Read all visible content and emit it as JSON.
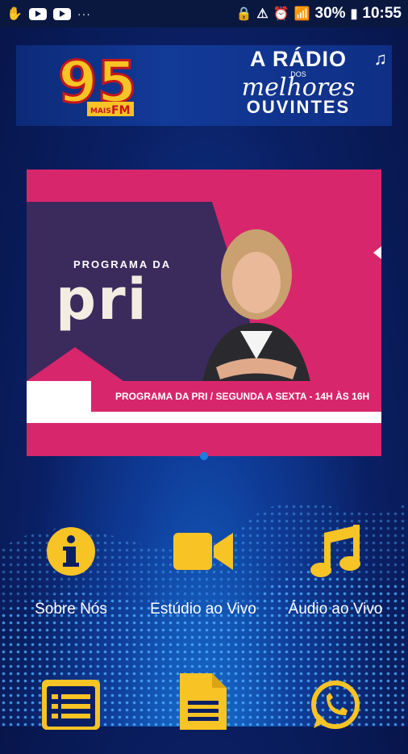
{
  "status_bar": {
    "battery_percent": "30%",
    "time": "10:55",
    "more_dots": "···"
  },
  "header": {
    "logo_number": "95",
    "logo_sub_left": "MAIS",
    "logo_sub_right": "FM",
    "slogan_line1": "A RÁDIO",
    "slogan_line2": "DOS",
    "slogan_line3": "melhores",
    "slogan_line4": "OUVINTES"
  },
  "carousel": {
    "program_kicker": "PROGRAMA DA",
    "program_name": "pri",
    "schedule_text": "PROGRAMA DA PRI  /  SEGUNDA A SEXTA - 14H ÀS 16H"
  },
  "menu": {
    "items": [
      {
        "label": "Sobre Nós",
        "icon": "info-icon"
      },
      {
        "label": "Estúdio ao Vivo",
        "icon": "video-camera-icon"
      },
      {
        "label": "Áudio ao Vivo",
        "icon": "music-note-icon"
      },
      {
        "label": "",
        "icon": "list-icon"
      },
      {
        "label": "",
        "icon": "document-icon"
      },
      {
        "label": "",
        "icon": "whatsapp-icon"
      }
    ]
  },
  "colors": {
    "accent_yellow": "#f7c325",
    "brand_pink": "#d8266c",
    "background_blue": "#0a1f63"
  }
}
